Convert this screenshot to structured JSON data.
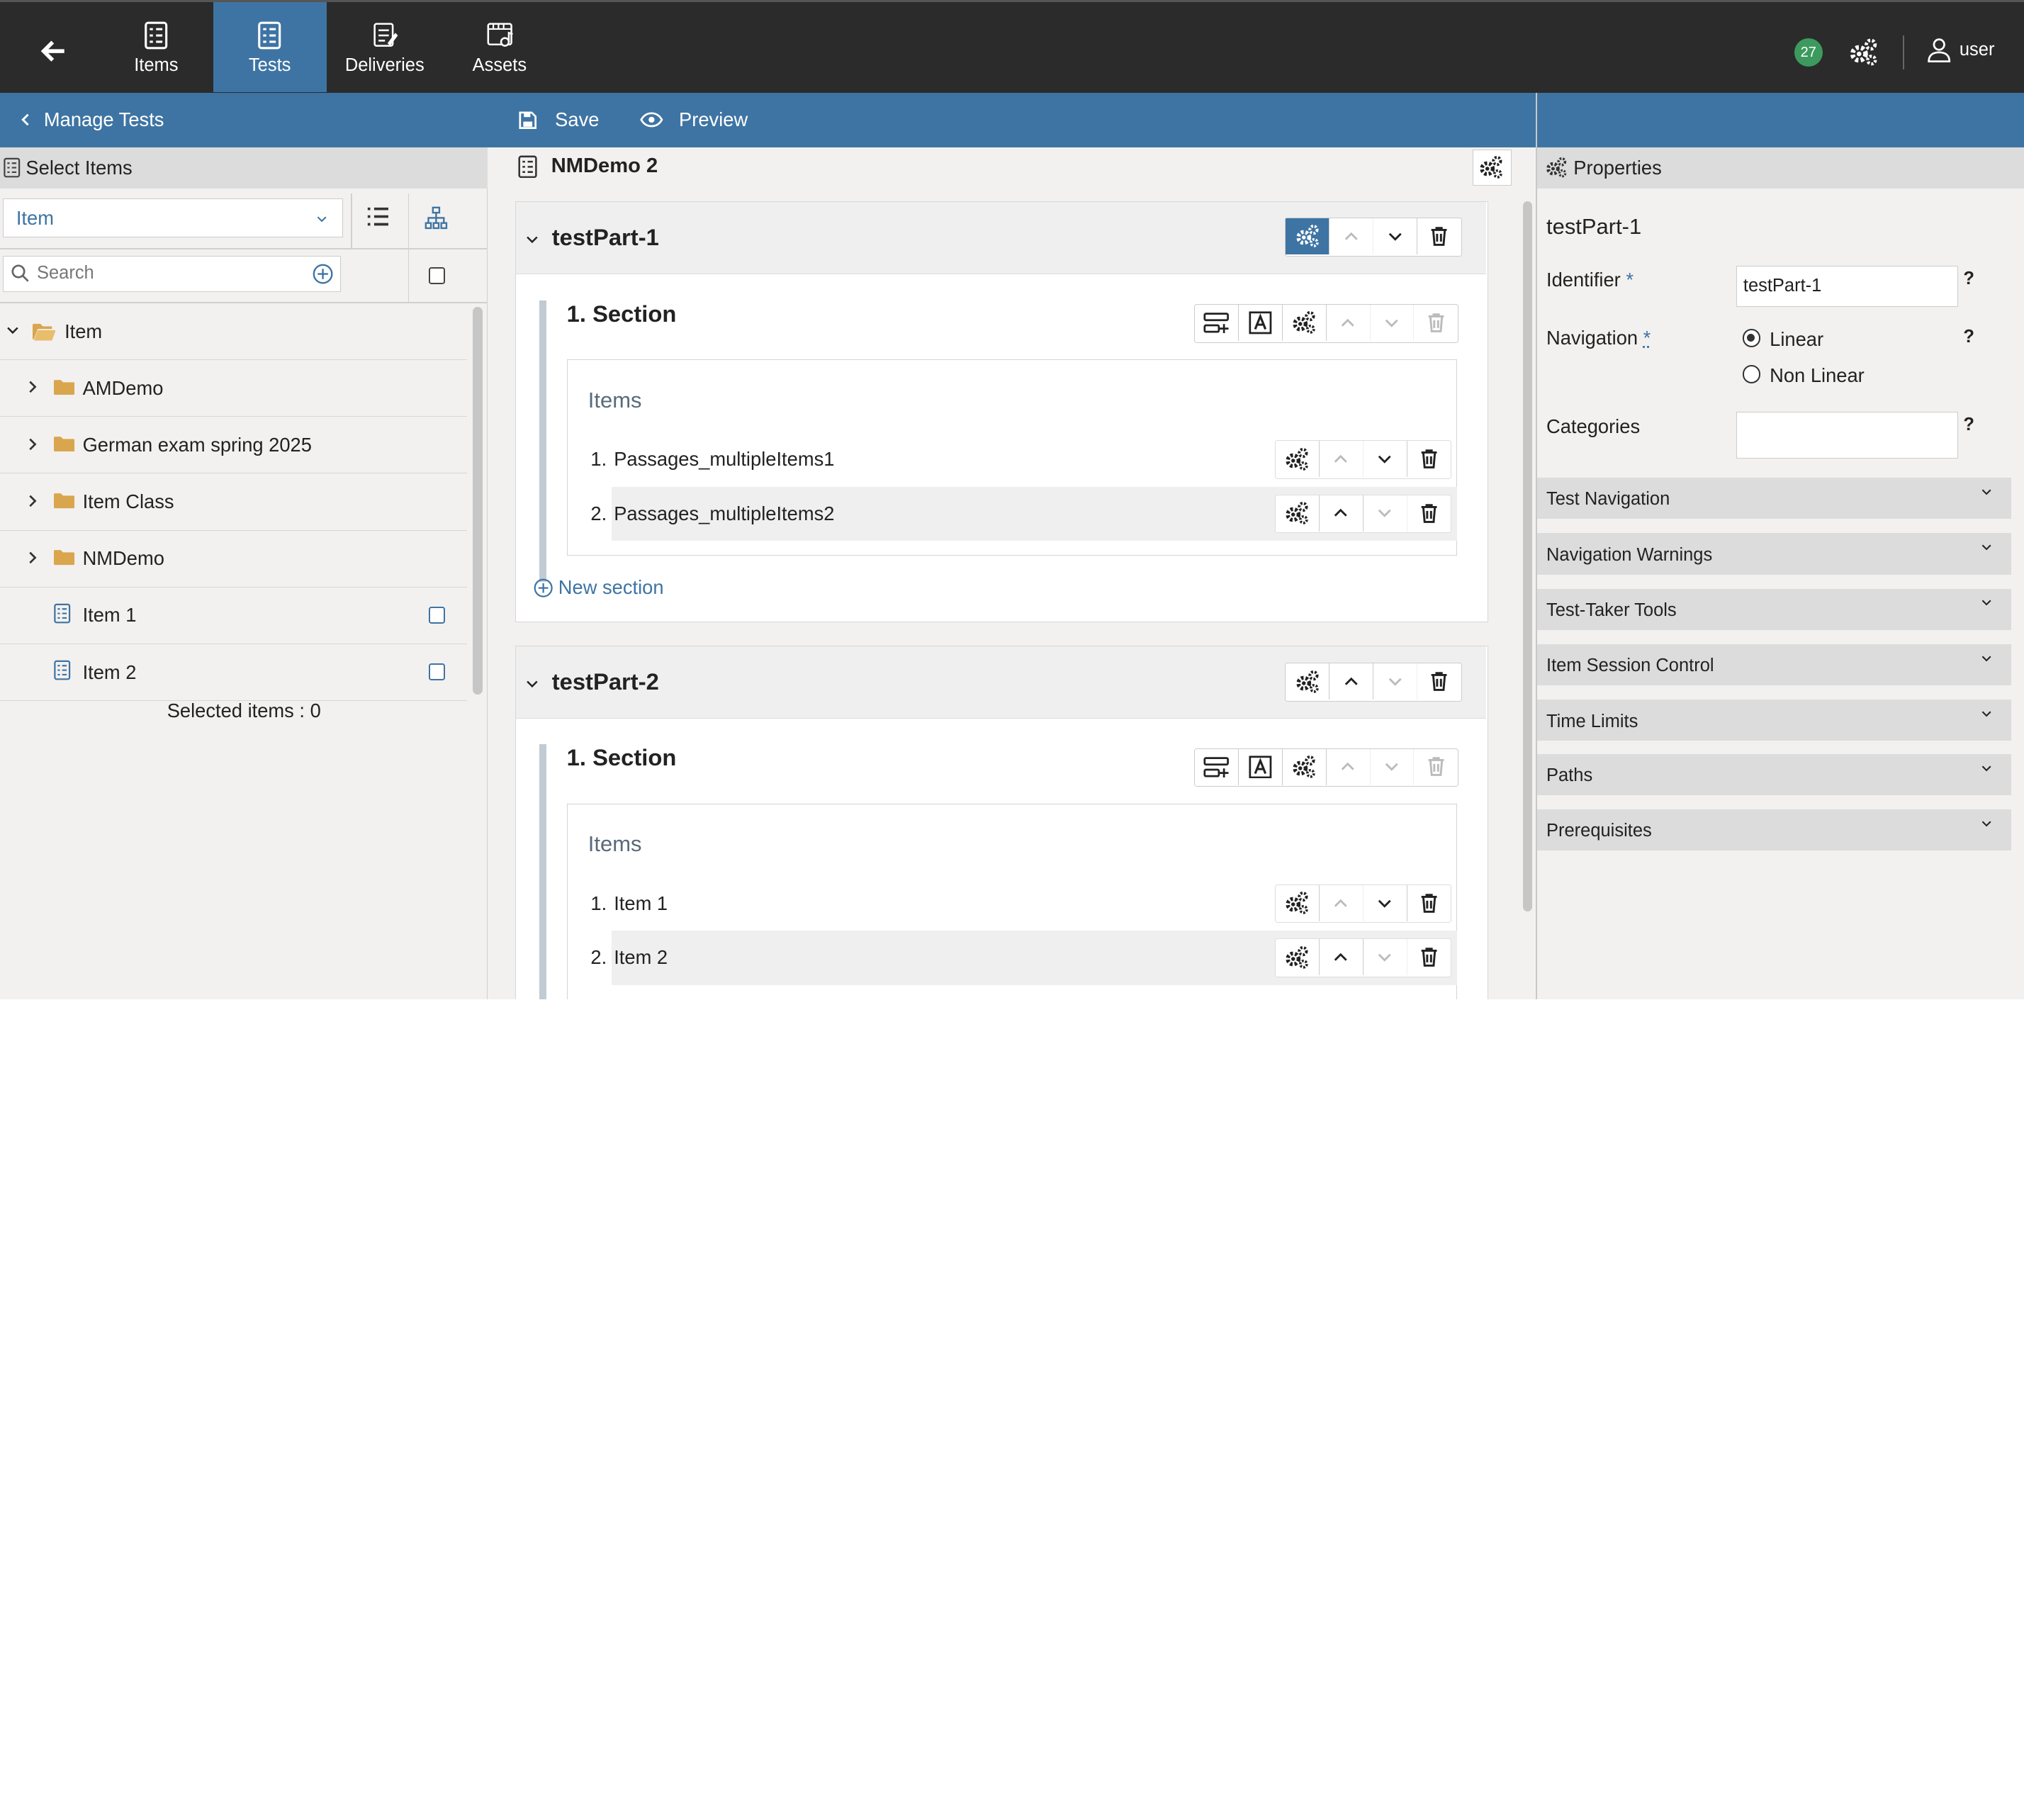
{
  "nav": {
    "tabs": [
      {
        "label": "Items"
      },
      {
        "label": "Tests"
      },
      {
        "label": "Deliveries"
      },
      {
        "label": "Assets"
      }
    ],
    "badge": "27",
    "user": "user"
  },
  "bar": {
    "manage": "Manage Tests",
    "save": "Save",
    "preview": "Preview"
  },
  "left": {
    "title": "Select Items",
    "type_value": "Item",
    "search_placeholder": "Search",
    "tree": {
      "root": "Item",
      "folders": [
        "AMDemo",
        "German exam spring 2025",
        "Item Class",
        "NMDemo"
      ],
      "items": [
        "Item 1",
        "Item 2"
      ]
    },
    "selected": "Selected items : 0"
  },
  "center": {
    "title": "NMDemo 2",
    "new_section": "New section",
    "parts": [
      {
        "name": "testPart-1",
        "section": "1. Section",
        "items_label": "Items",
        "items": [
          {
            "num": "1.",
            "label": "Passages_multipleItems1"
          },
          {
            "num": "2.",
            "label": "Passages_multipleItems2"
          }
        ]
      },
      {
        "name": "testPart-2",
        "section": "1. Section",
        "items_label": "Items",
        "items": [
          {
            "num": "1.",
            "label": "Item 1"
          },
          {
            "num": "2.",
            "label": "Item 2"
          }
        ]
      }
    ]
  },
  "right": {
    "title": "Properties",
    "heading": "testPart-1",
    "identifier_label": "Identifier",
    "identifier_req": "*",
    "identifier_value": "testPart-1",
    "navigation_label": "Navigation",
    "navigation_req": "*",
    "opt_linear": "Linear",
    "opt_nonlinear": "Non Linear",
    "categories_label": "Categories",
    "help": "?",
    "sections": [
      "Test Navigation",
      "Navigation Warnings",
      "Test-Taker Tools",
      "Item Session Control",
      "Time Limits",
      "Paths",
      "Prerequisites"
    ]
  },
  "colors": {
    "accent": "#3e74a3",
    "topbar": "#2b2b2b",
    "badge": "#3d9a5e"
  }
}
